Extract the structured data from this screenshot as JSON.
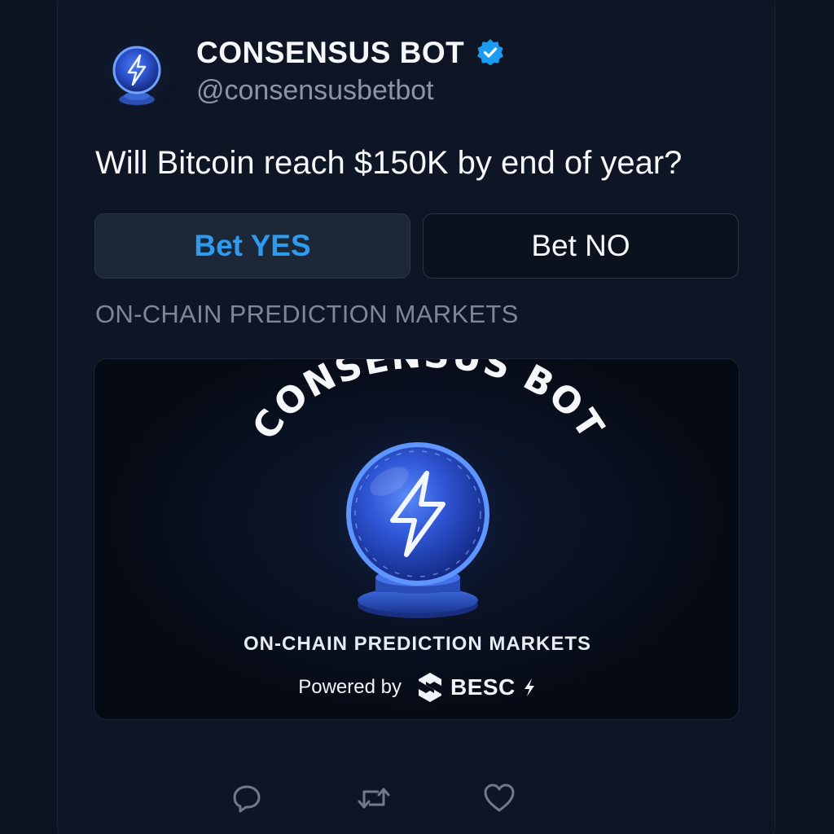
{
  "post": {
    "account_name": "CONSENSUS BOT",
    "handle": "@consensusbetbot",
    "verified": true,
    "question": "Will Bitcoin reach $150K by end of year?"
  },
  "buttons": {
    "yes_label": "Bet YES",
    "no_label": "Bet NO"
  },
  "subtitle": "ON-CHAIN PREDICTION MARKETS",
  "banner": {
    "arc_title": "CONSENSUS BOT",
    "tagline": "ON-CHAIN PREDICTION MARKETS",
    "powered_by": "Powered by",
    "brand": "BESC"
  },
  "actions": [
    {
      "icon": "reply-icon"
    },
    {
      "icon": "repost-icon"
    },
    {
      "icon": "like-icon"
    }
  ],
  "colors": {
    "background": "#0b1220",
    "card": "#0e1625",
    "accent_blue": "#2d9bf0",
    "verified_blue": "#1d9bf0",
    "orb_blue": "#3b6cf0",
    "muted_text": "#7d8799"
  }
}
